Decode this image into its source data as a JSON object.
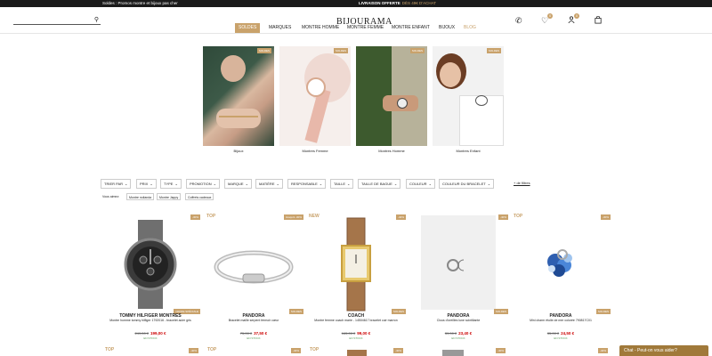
{
  "topbar": {
    "promo": "Soldes : Promos montre et bijoux pas cher",
    "delivery_bold": "LIVRAISON OFFERTE",
    "delivery_rest": "DÈS 49€ D'ACHAT"
  },
  "header": {
    "logo": "BIJOURAMA",
    "icons": [
      "phone-icon",
      "heart-icon",
      "user-icon",
      "bag-icon"
    ],
    "wishlist_count": "0",
    "account_count": "0"
  },
  "nav": {
    "items": [
      "SOLDES",
      "MARQUES",
      "MONTRE HOMME",
      "MONTRE FEMME",
      "MONTRE ENFANT",
      "BIJOUX",
      "BLOG"
    ]
  },
  "categories": [
    {
      "label": "Bijoux",
      "badge": "SOLDES"
    },
    {
      "label": "Montres Femme",
      "badge": "SOLDES"
    },
    {
      "label": "Montres Homme",
      "badge": "SOLDES"
    },
    {
      "label": "Montres Enfant",
      "badge": "SOLDES"
    }
  ],
  "filters": {
    "items": [
      "TRIER PAR",
      "PRIX",
      "TYPE",
      "PROMOTION",
      "MARQUE",
      "MATIÈRE",
      "RESPONSABLE",
      "TAILLE",
      "TAILLE DE BAGUE",
      "COULEUR",
      "COULEUR DU BRACELET"
    ],
    "more": "+ de filtres"
  },
  "tags": {
    "label": "Vous aimez:",
    "items": [
      "Montre noilanda",
      "Montre Jappy",
      "Coffrets cadeaux"
    ]
  },
  "products": [
    {
      "flag": "",
      "discount": "-30%",
      "ribbon": "OFFRE SPÉCIALE",
      "brand": "TOMMY HILFIGER MONTRES",
      "desc": "Montre homme tommy hilfiger 1792016 - bracelet acier gris",
      "old": "249,00 €",
      "price": "199,00 €",
      "stock": "EN STOCK"
    },
    {
      "flag": "TOP",
      "discount": "Jusqu'à -30%",
      "ribbon": "SOLDES",
      "brand": "PANDORA",
      "desc": "Bracelet maille serpent fermoir cœur",
      "old": "75,00 €",
      "price": "37,50 €",
      "stock": "EN STOCK"
    },
    {
      "flag": "NEW",
      "discount": "-40%",
      "ribbon": "SOLDES",
      "brand": "COACH",
      "desc": "Montre femme coach marie - 14504617 bracelet cuir marron",
      "old": "165,00 €",
      "price": "99,00 €",
      "stock": "EN STOCK"
    },
    {
      "flag": "",
      "discount": "-40%",
      "ribbon": "SOLDES",
      "brand": "PANDORA",
      "desc": "Clous d'oreilles lune scintillante",
      "old": "39,00 €",
      "price": "23,40 €",
      "stock": "EN STOCK"
    },
    {
      "flag": "TOP",
      "discount": "-30%",
      "ribbon": "SOLDES",
      "brand": "PANDORA",
      "desc": "Mini charm étoile de mer colorée 790817C01",
      "old": "35,00 €",
      "price": "24,50 €",
      "stock": "EN STOCK"
    }
  ],
  "row2": {
    "flags": [
      "TOP",
      "TOP",
      "TOP"
    ],
    "discounts": [
      "-40%",
      "-40%",
      "-40%",
      "-40%",
      "-40%"
    ]
  },
  "chat": {
    "label": "Chat - Peut-on vous aider?"
  },
  "colors": {
    "accent": "#c9a26b",
    "sale_price": "#cc0000",
    "stock": "#5a9a5a"
  }
}
